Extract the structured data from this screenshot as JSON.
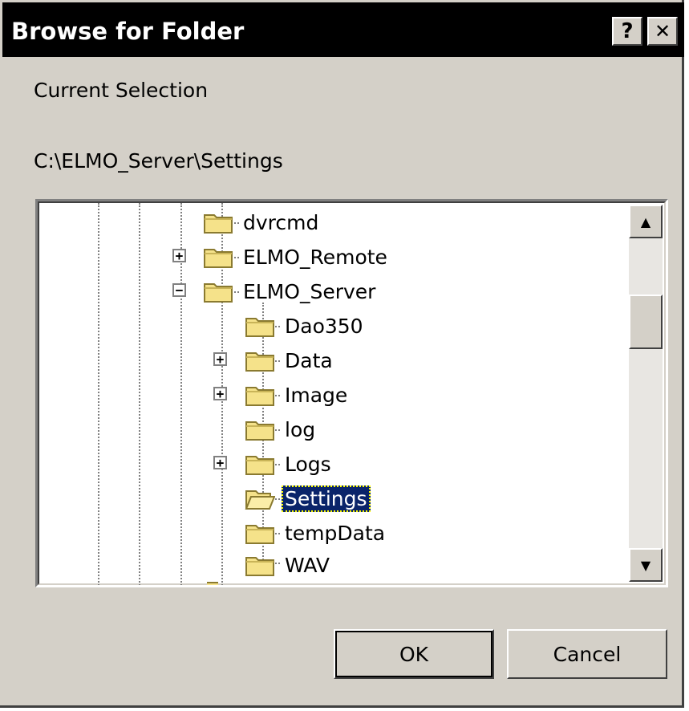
{
  "window": {
    "title": "Browse for Folder",
    "help_glyph": "?",
    "close_glyph": "✕"
  },
  "current_selection_label": "Current Selection",
  "current_path": "C:\\ELMO_Server\\Settings",
  "tree": {
    "nodes": [
      {
        "label": "dvrcmd",
        "expander": ""
      },
      {
        "label": "ELMO_Remote",
        "expander": "+"
      },
      {
        "label": "ELMO_Server",
        "expander": "−"
      },
      {
        "label": "Dao350",
        "expander": ""
      },
      {
        "label": "Data",
        "expander": "+"
      },
      {
        "label": "Image",
        "expander": "+"
      },
      {
        "label": "log",
        "expander": ""
      },
      {
        "label": "Logs",
        "expander": "+"
      },
      {
        "label": "Settings",
        "expander": "",
        "selected": true
      },
      {
        "label": "tempData",
        "expander": ""
      },
      {
        "label": "WAV",
        "expander": ""
      }
    ]
  },
  "scrollbar": {
    "up_glyph": "▲",
    "down_glyph": "▼"
  },
  "buttons": {
    "ok": "OK",
    "cancel": "Cancel"
  },
  "colors": {
    "selection": "#0a246a",
    "face": "#d4d0c8",
    "folder": "#f5e28a"
  }
}
